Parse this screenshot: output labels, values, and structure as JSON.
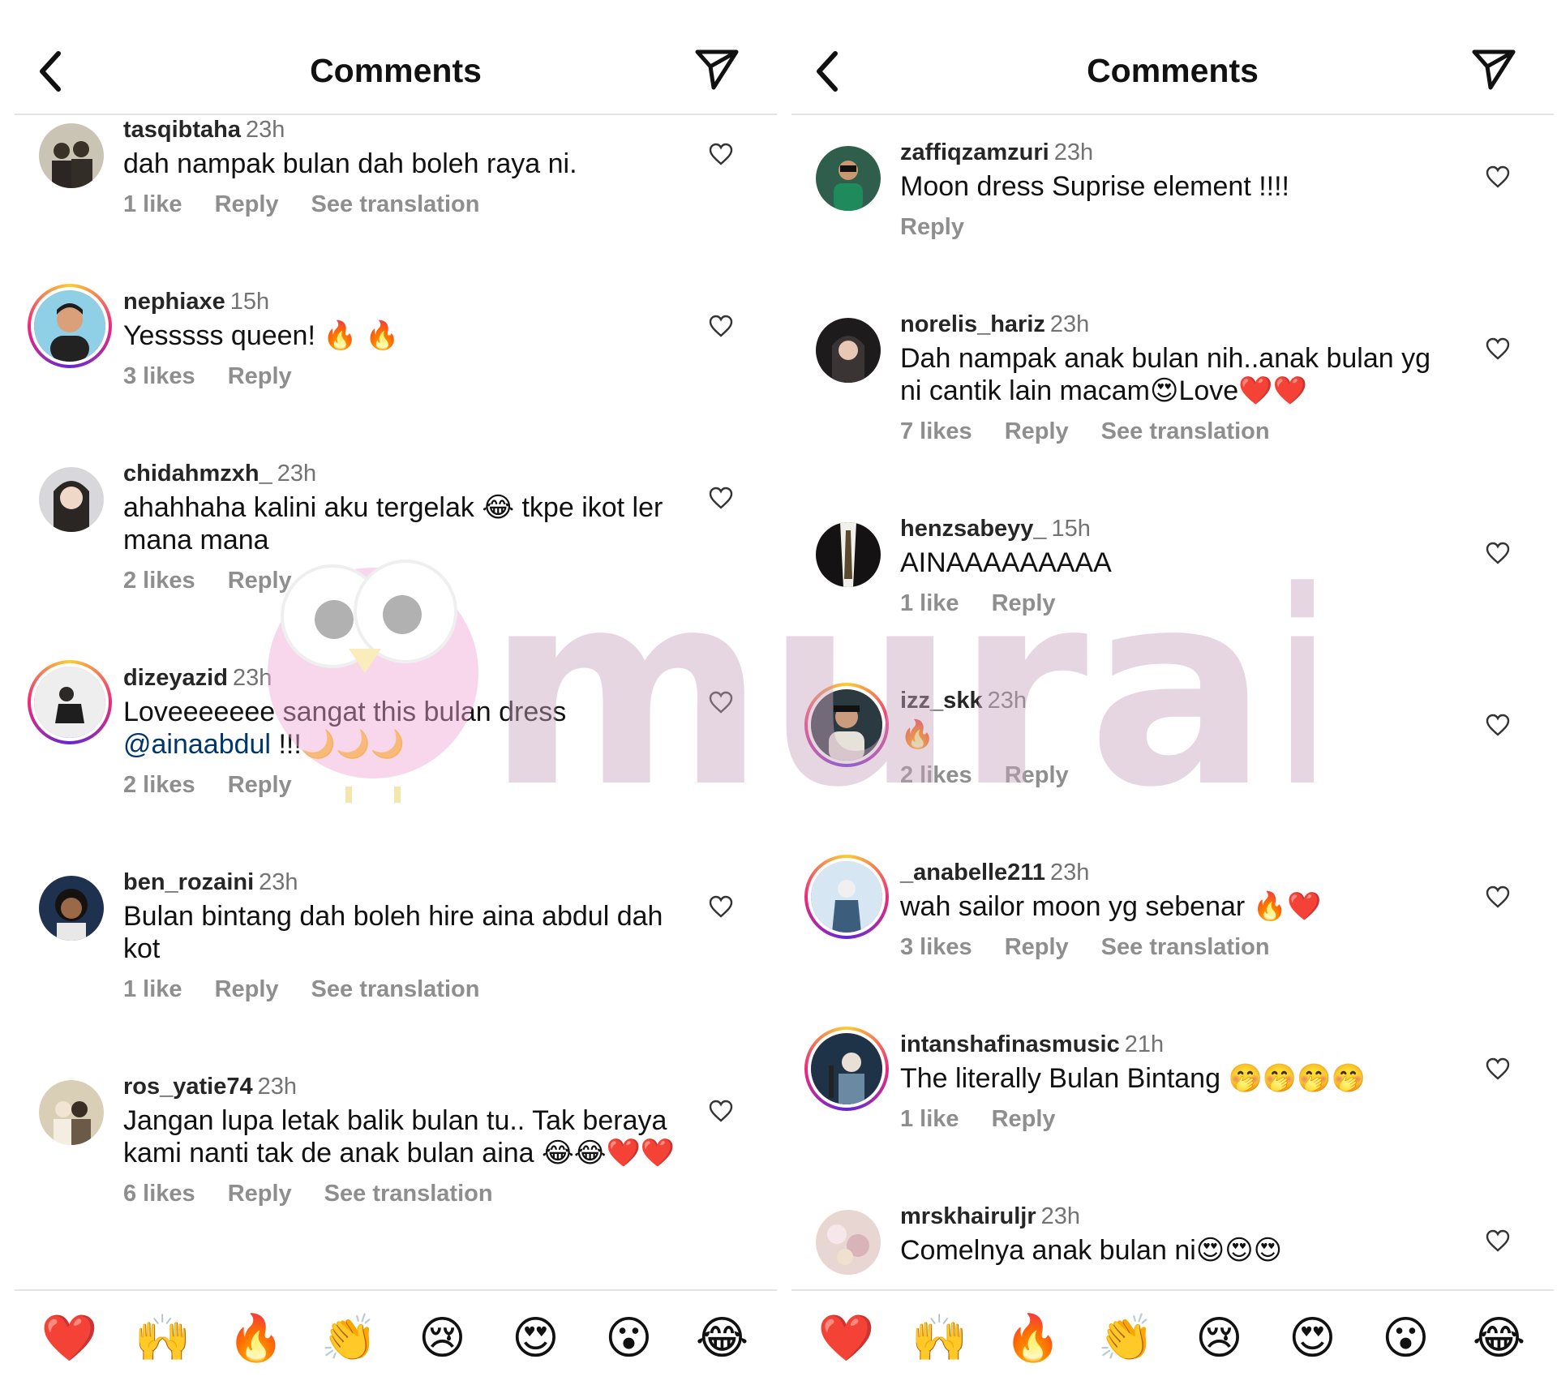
{
  "left": {
    "title": "Comments",
    "comments": [
      {
        "user": "tasqibtaha",
        "time": "23h",
        "text": "dah nampak bulan dah boleh raya ni.",
        "likes": "1 like",
        "reply": "Reply",
        "translate": "See translation"
      },
      {
        "user": "nephiaxe",
        "time": "15h",
        "text": "Yesssss queen! 🔥 🔥",
        "likes": "3 likes",
        "reply": "Reply",
        "translate": ""
      },
      {
        "user": "chidahmzxh_",
        "time": "23h",
        "text": "ahahhaha kalini aku tergelak 😂 tkpe ikot ler mana mana",
        "likes": "2 likes",
        "reply": "Reply",
        "translate": ""
      },
      {
        "user": "dizeyazid",
        "time": "23h",
        "text": "Loveeeeeee sangat this bulan dress ",
        "mention": "@ainaabdul",
        "text_after": " !!!🌙🌙🌙",
        "likes": "2 likes",
        "reply": "Reply",
        "translate": ""
      },
      {
        "user": "ben_rozaini",
        "time": "23h",
        "text": "Bulan bintang dah boleh hire aina abdul dah kot",
        "likes": "1 like",
        "reply": "Reply",
        "translate": "See translation"
      },
      {
        "user": "ros_yatie74",
        "time": "23h",
        "text": "Jangan lupa letak balik bulan tu.. Tak beraya kami nanti tak de anak bulan aina 😂😂❤️❤️",
        "likes": "6 likes",
        "reply": "Reply",
        "translate": "See translation"
      }
    ],
    "emojis": [
      "❤️",
      "🙌",
      "🔥",
      "👏",
      "😢",
      "😍",
      "😮",
      "😂"
    ]
  },
  "right": {
    "title": "Comments",
    "comments": [
      {
        "user": "zaffiqzamzuri",
        "time": "23h",
        "text": "Moon dress Suprise element !!!!",
        "likes": "",
        "reply": "Reply",
        "translate": ""
      },
      {
        "user": "norelis_hariz",
        "time": "23h",
        "text": "Dah nampak anak bulan nih..anak bulan yg ni cantik lain macam😍Love❤️❤️",
        "likes": "7 likes",
        "reply": "Reply",
        "translate": "See translation"
      },
      {
        "user": "henzsabeyy_",
        "time": "15h",
        "text": "AINAAAAAAAAA",
        "likes": "1 like",
        "reply": "Reply",
        "translate": ""
      },
      {
        "user": "izz_skk",
        "time": "23h",
        "text": "🔥",
        "likes": "2 likes",
        "reply": "Reply",
        "translate": ""
      },
      {
        "user": "_anabelle211",
        "time": "23h",
        "text": "wah sailor moon yg sebenar 🔥❤️",
        "likes": "3 likes",
        "reply": "Reply",
        "translate": "See translation"
      },
      {
        "user": "intanshafinasmusic",
        "time": "21h",
        "text": "The literally Bulan Bintang 🤭🤭🤭🤭",
        "likes": "1 like",
        "reply": "Reply",
        "translate": ""
      },
      {
        "user": "mrskhairuljr",
        "time": "23h",
        "text": "Comelnya anak bulan ni😍😍😍",
        "likes": "",
        "reply": "",
        "translate": ""
      }
    ],
    "emojis": [
      "❤️",
      "🙌",
      "🔥",
      "👏",
      "😢",
      "😍",
      "😮",
      "😂"
    ]
  },
  "watermark": {
    "text": "murai"
  }
}
